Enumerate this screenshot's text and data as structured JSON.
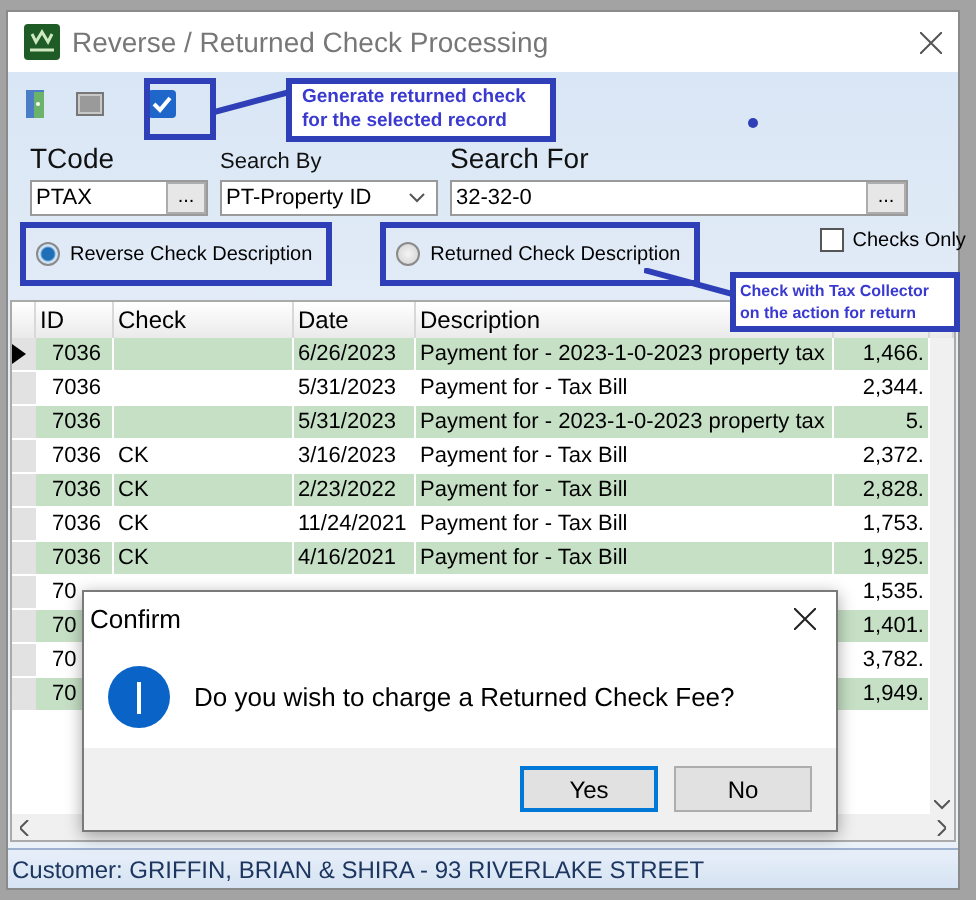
{
  "window": {
    "title": "Reverse / Returned Check Processing"
  },
  "fields": {
    "tcode": {
      "label": "TCode",
      "value": "PTAX",
      "button": "..."
    },
    "search_by": {
      "label": "Search By",
      "value": "PT-Property ID"
    },
    "search_for": {
      "label": "Search For",
      "value": "32-32-0",
      "button": "..."
    }
  },
  "radios": [
    {
      "label": "Reverse Check Description",
      "selected": true
    },
    {
      "label": "Returned Check Description",
      "selected": false
    }
  ],
  "checks_only": {
    "label": "Checks Only",
    "checked": false
  },
  "annotations": [
    {
      "text": "Generate returned check for the selected record"
    },
    {
      "text": "Check with Tax Collector on the action for return"
    }
  ],
  "table": {
    "columns": [
      "ID",
      "Check",
      "Date",
      "Description"
    ],
    "rows": [
      {
        "id": "7036",
        "check": "",
        "date": "6/26/2023",
        "description": "Payment for - 2023-1-0-2023 property tax",
        "column_5": "1,466.",
        "selected": true
      },
      {
        "id": "7036",
        "check": "",
        "date": "5/31/2023",
        "description": "Payment for - Tax Bill",
        "column_5": "2,344.",
        "selected": false
      },
      {
        "id": "7036",
        "check": "",
        "date": "5/31/2023",
        "description": "Payment for - 2023-1-0-2023 property tax",
        "column_5": "5.",
        "selected": false
      },
      {
        "id": "7036",
        "check": "CK",
        "date": "3/16/2023",
        "description": "Payment for - Tax Bill",
        "column_5": "2,372.",
        "selected": false
      },
      {
        "id": "7036",
        "check": "CK",
        "date": "2/23/2022",
        "description": "Payment for - Tax Bill",
        "column_5": "2,828.",
        "selected": false
      },
      {
        "id": "7036",
        "check": "CK",
        "date": "11/24/2021",
        "description": "Payment for - Tax Bill",
        "column_5": "1,753.",
        "selected": false
      },
      {
        "id": "7036",
        "check": "CK",
        "date": "4/16/2021",
        "description": "Payment for - Tax Bill",
        "column_5": "1,925.",
        "selected": false
      },
      {
        "id": "70",
        "check": "",
        "date": "",
        "description": "",
        "column_5": "1,535.",
        "selected": false
      },
      {
        "id": "70",
        "check": "",
        "date": "",
        "description": "",
        "column_5": "1,401.",
        "selected": false
      },
      {
        "id": "70",
        "check": "",
        "date": "",
        "description": "",
        "column_5": "3,782.",
        "selected": false
      },
      {
        "id": "70",
        "check": "",
        "date": "",
        "description": "",
        "column_5": "1,949.",
        "selected": false
      }
    ]
  },
  "dialog": {
    "title": "Confirm",
    "message": "Do you wish to charge a Returned Check Fee?",
    "buttons": [
      {
        "label": "Yes",
        "focused": true
      },
      {
        "label": "No",
        "focused": false
      }
    ]
  },
  "status_bar": "Customer: GRIFFIN, BRIAN & SHIRA - 93 RIVERLAKE STREET"
}
